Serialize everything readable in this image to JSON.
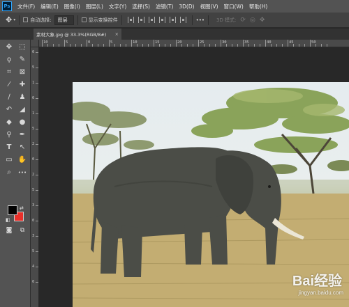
{
  "app": {
    "logo": "Ps",
    "menus": [
      "文件(F)",
      "编辑(E)",
      "图像(I)",
      "图层(L)",
      "文字(Y)",
      "选择(S)",
      "滤镜(T)",
      "3D(D)",
      "视图(V)",
      "窗口(W)",
      "帮助(H)"
    ]
  },
  "options": {
    "auto_select_label": "自动选择:",
    "auto_select_value": "图层",
    "show_transform_label": "显示变换控件",
    "more_label": "•••",
    "mode_3d_label": "3D 模式:"
  },
  "document": {
    "tab_title": "素材大象.jpg @ 33.3%(RGB/8#)",
    "close_glyph": "×"
  },
  "rulers": {
    "top_labels": [
      "10",
      "5",
      "0",
      "5",
      "10",
      "15",
      "20",
      "25",
      "30",
      "35",
      "40",
      "45",
      "50"
    ],
    "left_labels": [
      "0",
      "5",
      "1",
      "0",
      "1",
      "5",
      "2",
      "0",
      "2",
      "5",
      "3",
      "0",
      "3",
      "5",
      "4",
      "0"
    ]
  },
  "tools": {
    "items": [
      {
        "name": "move-tool",
        "glyph": "✥"
      },
      {
        "name": "marquee-tool",
        "glyph": "⬚"
      },
      {
        "name": "lasso-tool",
        "glyph": "ϙ"
      },
      {
        "name": "quick-select-tool",
        "glyph": "✎"
      },
      {
        "name": "crop-tool",
        "glyph": "⌗"
      },
      {
        "name": "frame-tool",
        "glyph": "⊠"
      },
      {
        "name": "eyedropper-tool",
        "glyph": "⁄"
      },
      {
        "name": "healing-tool",
        "glyph": "✚"
      },
      {
        "name": "brush-tool",
        "glyph": "∕"
      },
      {
        "name": "stamp-tool",
        "glyph": "♟"
      },
      {
        "name": "history-brush-tool",
        "glyph": "↶"
      },
      {
        "name": "eraser-tool",
        "glyph": "◢"
      },
      {
        "name": "paint-bucket-tool",
        "glyph": "◆"
      },
      {
        "name": "blur-tool",
        "glyph": "●"
      },
      {
        "name": "dodge-tool",
        "glyph": "⚲"
      },
      {
        "name": "pen-tool",
        "glyph": "✒"
      },
      {
        "name": "type-tool",
        "glyph": "T"
      },
      {
        "name": "path-select-tool",
        "glyph": "↖"
      },
      {
        "name": "rectangle-tool",
        "glyph": "▭"
      },
      {
        "name": "hand-tool",
        "glyph": "✋"
      },
      {
        "name": "zoom-tool",
        "glyph": "⌕"
      },
      {
        "name": "more-tools",
        "glyph": "•••"
      }
    ],
    "foreground_color": "#000000",
    "background_color": "#e8302a"
  },
  "watermark": {
    "text": "Bai经验",
    "url": "jingyan.baidu.com"
  }
}
